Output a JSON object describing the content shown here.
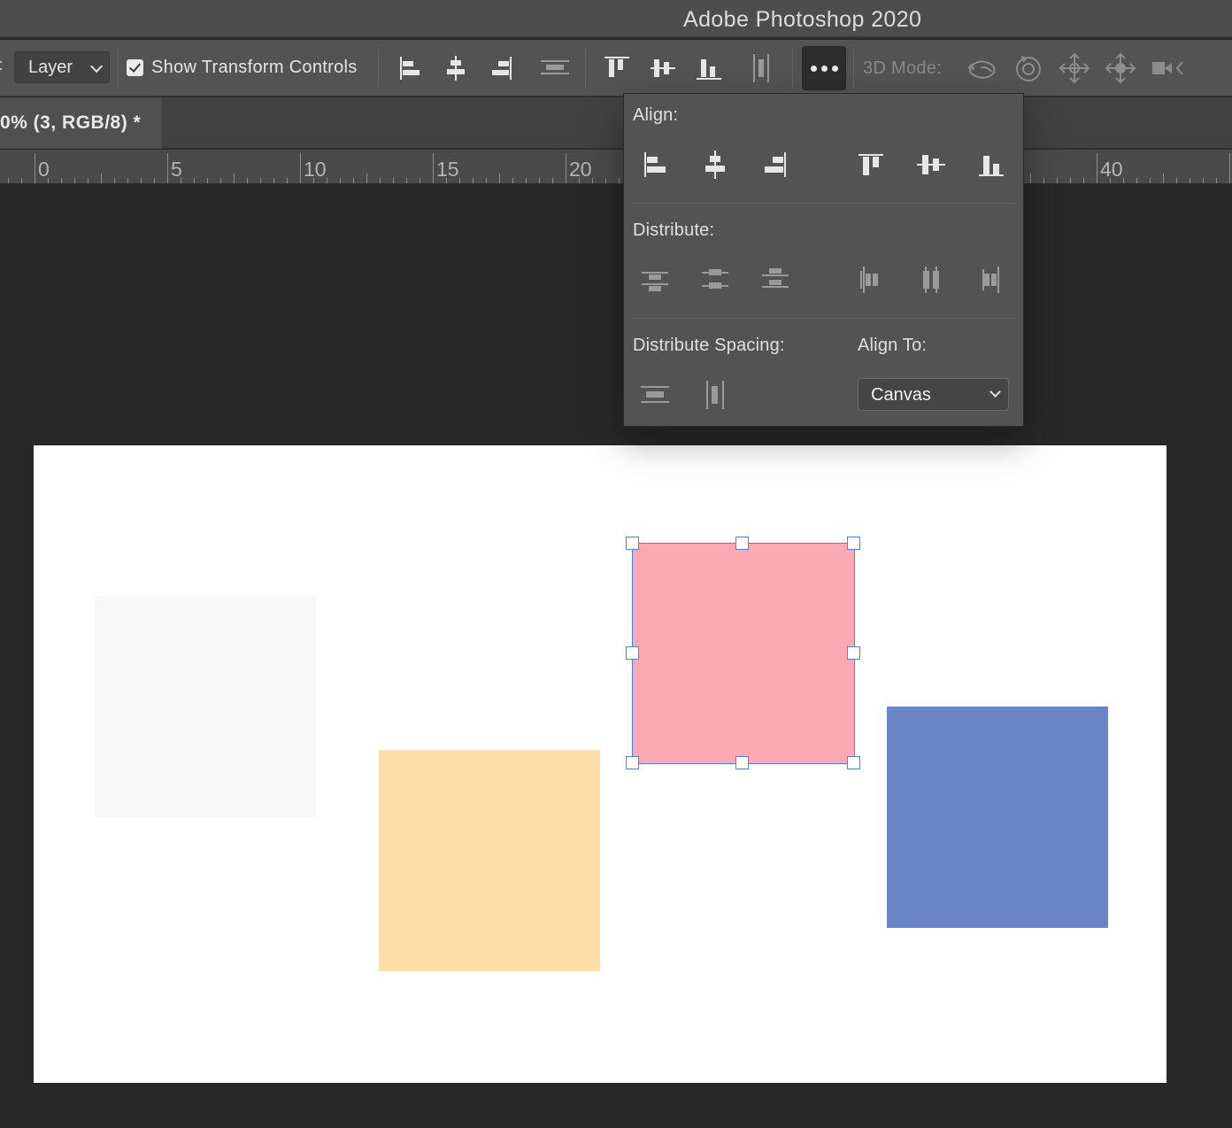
{
  "app": {
    "title": "Adobe Photoshop 2020"
  },
  "options_bar": {
    "auto_select_target": "Layer",
    "show_transform_controls": {
      "label": "Show Transform Controls",
      "checked": true
    },
    "three_d_mode_label": "3D Mode:",
    "align_icons": [
      "align-left-edges-icon",
      "align-horizontal-centers-icon",
      "align-right-edges-icon",
      "distribute-vertical-spacing-icon",
      "align-top-edges-icon",
      "align-vertical-centers-icon",
      "align-bottom-edges-icon",
      "distribute-horizontal-spacing-icon"
    ],
    "more_options_icon": "more-options-icon",
    "three_d_icons": [
      "orbit-3d-icon",
      "roll-3d-icon",
      "drag-3d-icon",
      "slide-3d-icon",
      "scale-3d-icon"
    ]
  },
  "document_tab": {
    "label": "0% (3, RGB/8) *"
  },
  "ruler": {
    "labels": [
      "0",
      "5",
      "10",
      "15",
      "20",
      "40"
    ]
  },
  "canvas": {
    "layers": [
      {
        "name": "gray-square",
        "color": "#f8f8f8"
      },
      {
        "name": "peach-square",
        "color": "#fedfaa"
      },
      {
        "name": "pink-square",
        "color": "#fda9b4",
        "selected": true
      },
      {
        "name": "blue-square",
        "color": "#6a85c5"
      }
    ],
    "selection_color": "#4f7fe8"
  },
  "align_popover": {
    "align_label": "Align:",
    "distribute_label": "Distribute:",
    "distribute_spacing_label": "Distribute Spacing:",
    "align_to_label": "Align To:",
    "align_to_value": "Canvas",
    "align_icons": [
      "align-left-edges-icon",
      "align-horizontal-centers-icon",
      "align-right-edges-icon",
      "align-top-edges-icon",
      "align-vertical-centers-icon",
      "align-bottom-edges-icon"
    ],
    "distribute_icons": [
      "distribute-top-edges-icon",
      "distribute-vertical-centers-icon",
      "distribute-bottom-edges-icon",
      "distribute-left-edges-icon",
      "distribute-horizontal-centers-icon",
      "distribute-right-edges-icon"
    ],
    "distribute_spacing_icons": [
      "distribute-vertical-spacing-icon",
      "distribute-horizontal-spacing-icon"
    ]
  }
}
